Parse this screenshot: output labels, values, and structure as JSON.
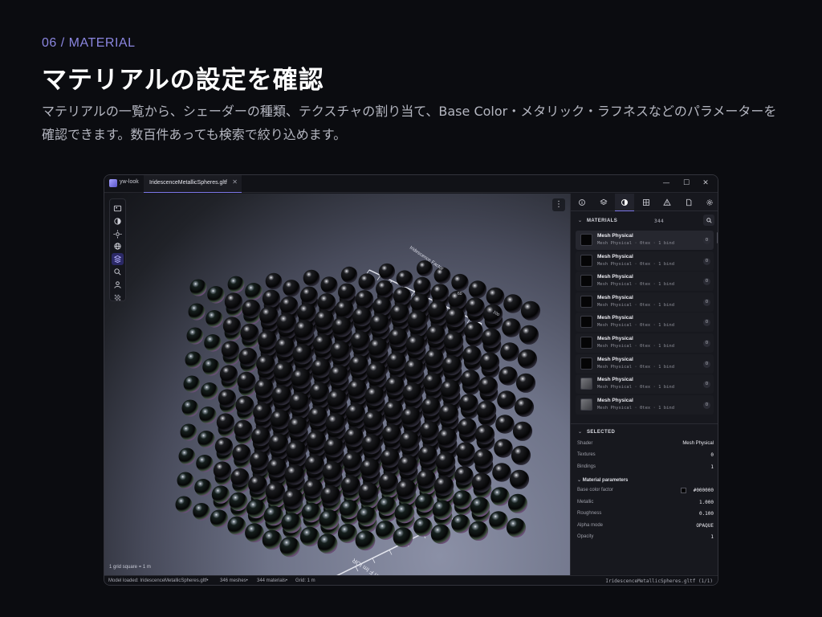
{
  "page": {
    "kicker": "06 / MATERIAL",
    "headline": "マテリアルの設定を確認",
    "lede": "マテリアルの一覧から、シェーダーの種類、テクスチャの割り当て、Base Color・メタリック・ラフネスなどのパラメーターを確認できます。数百件あっても検索で絞り込めます。"
  },
  "window": {
    "app_name": "yw-look",
    "file_tab": "IridescenceMetallicSpheres.gltf",
    "close_tab": "✕",
    "controls": {
      "minimize": "—",
      "maximize": "☐",
      "close": "✕"
    }
  },
  "viewport": {
    "more": "⋮",
    "grid_hint": "1 grid square = 1 m",
    "axis_label_bottom": "Thin F Im IOR",
    "axis_label_top": "Iridescence Factor",
    "axis_tick_100": "100",
    "axis_tick_60": "60"
  },
  "toolbar_icons": [
    "image-icon",
    "sphere-outline-icon",
    "sun-icon",
    "globe-icon",
    "cube-stack-icon",
    "search-icon",
    "person-icon",
    "checker-icon"
  ],
  "panel": {
    "tab_icons": [
      "info-icon",
      "layers-icon",
      "material-icon",
      "texture-icon",
      "warning-icon",
      "file-icon",
      "gear-icon"
    ],
    "materials_header": "MATERIALS",
    "materials_count": "344",
    "materials": [
      {
        "name": "Mesh Physical",
        "sub": "Mesh Physical · 0tex · 1 bind",
        "badge": "0",
        "swatch": "black"
      },
      {
        "name": "Mesh Physical",
        "sub": "Mesh Physical · 0tex · 1 bind",
        "badge": "0",
        "swatch": "black"
      },
      {
        "name": "Mesh Physical",
        "sub": "Mesh Physical · 0tex · 1 bind",
        "badge": "0",
        "swatch": "black"
      },
      {
        "name": "Mesh Physical",
        "sub": "Mesh Physical · 0tex · 1 bind",
        "badge": "0",
        "swatch": "black"
      },
      {
        "name": "Mesh Physical",
        "sub": "Mesh Physical · 0tex · 1 bind",
        "badge": "0",
        "swatch": "black"
      },
      {
        "name": "Mesh Physical",
        "sub": "Mesh Physical · 0tex · 1 bind",
        "badge": "0",
        "swatch": "black"
      },
      {
        "name": "Mesh Physical",
        "sub": "Mesh Physical · 0tex · 1 bind",
        "badge": "0",
        "swatch": "black"
      },
      {
        "name": "Mesh Physical",
        "sub": "Mesh Physical · 0tex · 1 bind",
        "badge": "0",
        "swatch": "gray"
      },
      {
        "name": "Mesh Physical",
        "sub": "Mesh Physical · 0tex · 1 bind",
        "badge": "0",
        "swatch": "gray"
      }
    ],
    "selected_header": "SELECTED",
    "shader_label": "Shader",
    "shader_value": "Mesh Physical",
    "textures_label": "Textures",
    "textures_value": "0",
    "bindings_label": "Bindings",
    "bindings_value": "1",
    "params_header": "Material parameters",
    "base_color_label": "Base color factor",
    "base_color_value": "#000000",
    "metallic_label": "Metallic",
    "metallic_value": "1.000",
    "roughness_label": "Roughness",
    "roughness_value": "0.100",
    "alpha_mode_label": "Alpha mode",
    "alpha_mode_value": "OPAQUE",
    "opacity_label": "Opacity",
    "opacity_value": "1"
  },
  "status": {
    "loaded": "Model loaded: IridescenceMetallicSpheres.gltf•",
    "meshes": "346 meshes•",
    "materials": "344 materials•",
    "grid": "Grid: 1 m",
    "right": "IridescenceMetallicSpheres.gltf (1/1)"
  },
  "colors": {
    "accent": "#7b76e6",
    "kicker": "#8b86e0",
    "background": "#0b0c10"
  }
}
